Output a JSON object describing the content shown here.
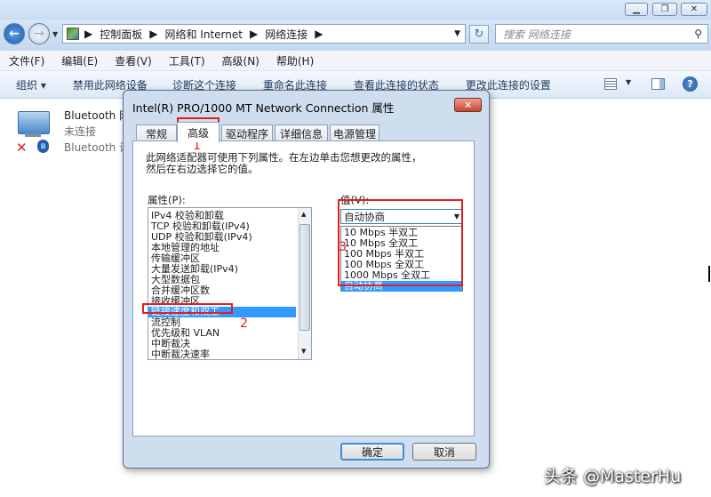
{
  "address": {
    "breadcrumb": [
      "控制面板",
      "网络和 Internet",
      "网络连接"
    ],
    "search_placeholder": "搜索 网络连接"
  },
  "menu": [
    "文件(F)",
    "编辑(E)",
    "查看(V)",
    "工具(T)",
    "高级(N)",
    "帮助(H)"
  ],
  "toolbar": {
    "organize": "组织 ▾",
    "commands": [
      "禁用此网络设备",
      "诊断这个连接",
      "重命名此连接",
      "查看此连接的状态",
      "更改此连接的设置"
    ]
  },
  "connection": {
    "name": "Bluetooth 网",
    "status": "未连接",
    "device": "Bluetooth 设"
  },
  "dialog": {
    "title": "Intel(R) PRO/1000 MT Network Connection 属性",
    "tabs": [
      "常规",
      "高级",
      "驱动程序",
      "详细信息",
      "电源管理"
    ],
    "description_line1": "此网络适配器可使用下列属性。在左边单击您想更改的属性，",
    "description_line2": "然后在右边选择它的值。",
    "property_label": "属性(P):",
    "value_label": "值(V):",
    "properties": [
      "IPv4 校验和卸载",
      "TCP 校验和卸载(IPv4)",
      "UDP 校验和卸载(IPv4)",
      "本地管理的地址",
      "传输缓冲区",
      "大量发送卸载(IPv4)",
      "大型数据包",
      "合并缓冲区数",
      "接收缓冲区",
      "链接速度和双工",
      "流控制",
      "优先级和 VLAN",
      "中断裁决",
      "中断裁决速率"
    ],
    "selected_property": "链接速度和双工",
    "value_selected": "自动协商",
    "value_options": [
      "10 Mbps 半双工",
      "10 Mbps 全双工",
      "100 Mbps 半双工",
      "100 Mbps 全双工",
      "1000 Mbps 全双工",
      "自动协商"
    ],
    "ok": "确定",
    "cancel": "取消"
  },
  "annotations": {
    "n1": "1",
    "n2": "2",
    "n3": "3",
    "color": "#e02020"
  },
  "watermark": "头条 @MasterHu"
}
